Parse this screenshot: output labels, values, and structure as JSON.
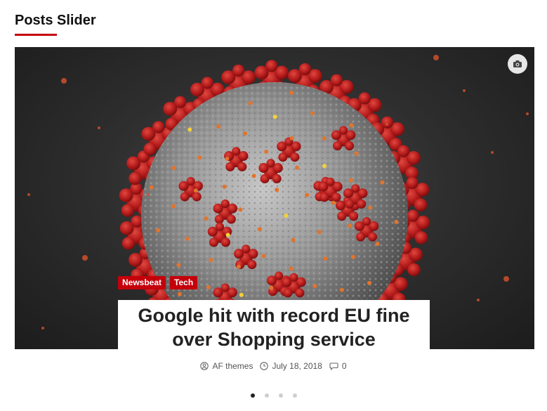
{
  "widget": {
    "title": "Posts Slider"
  },
  "slide": {
    "categories": [
      "Newsbeat",
      "Tech"
    ],
    "headline": "Google hit with record EU fine over Shopping service",
    "author": "AF themes",
    "date": "July 18, 2018",
    "comments": "0",
    "image_icon": "camera-icon"
  },
  "slider": {
    "dots": 4,
    "active_index": 0
  },
  "colors": {
    "accent": "#c4000a",
    "virus_spike": "#b81d1d",
    "virus_body": "#9a9a9a"
  }
}
